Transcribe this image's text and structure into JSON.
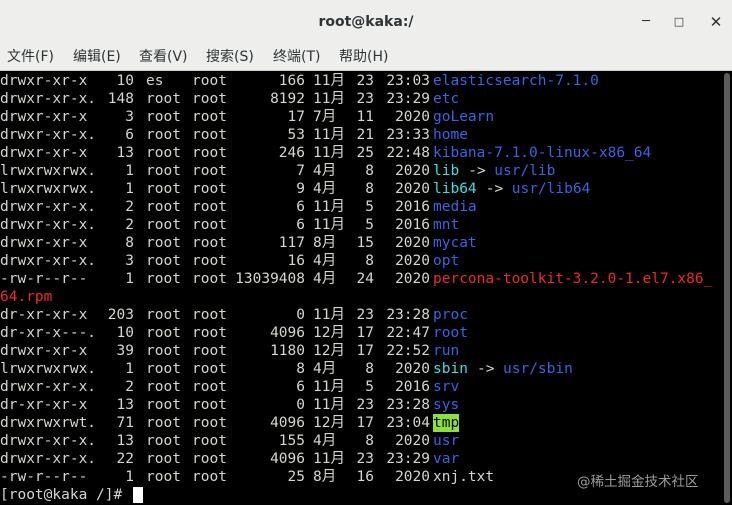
{
  "window": {
    "title": "root@kaka:/"
  },
  "menu": [
    "文件(F)",
    "编辑(E)",
    "查看(V)",
    "搜索(S)",
    "终端(T)",
    "帮助(H)"
  ],
  "rows": [
    {
      "perm": "drwxr-xr-x ",
      "links": "10",
      "owner": "es",
      "group": "root",
      "size": "166",
      "month": "11月",
      "day": "23",
      "time": "23:03",
      "name": "elasticsearch-7.1.0",
      "color": "blue"
    },
    {
      "perm": "drwxr-xr-x.",
      "links": "148",
      "owner": "root",
      "group": "root",
      "size": "8192",
      "month": "11月",
      "day": "23",
      "time": "23:29",
      "name": "etc",
      "color": "blue"
    },
    {
      "perm": "drwxr-xr-x ",
      "links": "3",
      "owner": "root",
      "group": "root",
      "size": "17",
      "month": "7月",
      "day": "11",
      "time": "2020",
      "name": "goLearn",
      "color": "blue"
    },
    {
      "perm": "drwxr-xr-x.",
      "links": "6",
      "owner": "root",
      "group": "root",
      "size": "53",
      "month": "11月",
      "day": "21",
      "time": "23:33",
      "name": "home",
      "color": "blue"
    },
    {
      "perm": "drwxr-xr-x ",
      "links": "13",
      "owner": "root",
      "group": "root",
      "size": "246",
      "month": "11月",
      "day": "25",
      "time": "22:48",
      "name": "kibana-7.1.0-linux-x86_64",
      "color": "blue"
    },
    {
      "perm": "lrwxrwxrwx.",
      "links": "1",
      "owner": "root",
      "group": "root",
      "size": "7",
      "month": "4月",
      "day": "8",
      "time": "2020",
      "name": "lib",
      "color": "cyan",
      "arrow": "->",
      "target": "usr/lib"
    },
    {
      "perm": "lrwxrwxrwx.",
      "links": "1",
      "owner": "root",
      "group": "root",
      "size": "9",
      "month": "4月",
      "day": "8",
      "time": "2020",
      "name": "lib64",
      "color": "cyan",
      "arrow": "->",
      "target": "usr/lib64"
    },
    {
      "perm": "drwxr-xr-x.",
      "links": "2",
      "owner": "root",
      "group": "root",
      "size": "6",
      "month": "11月",
      "day": "5",
      "time": "2016",
      "name": "media",
      "color": "blue"
    },
    {
      "perm": "drwxr-xr-x.",
      "links": "2",
      "owner": "root",
      "group": "root",
      "size": "6",
      "month": "11月",
      "day": "5",
      "time": "2016",
      "name": "mnt",
      "color": "blue"
    },
    {
      "perm": "drwxr-xr-x ",
      "links": "8",
      "owner": "root",
      "group": "root",
      "size": "117",
      "month": "8月",
      "day": "15",
      "time": "2020",
      "name": "mycat",
      "color": "blue"
    },
    {
      "perm": "drwxr-xr-x.",
      "links": "3",
      "owner": "root",
      "group": "root",
      "size": "16",
      "month": "4月",
      "day": "8",
      "time": "2020",
      "name": "opt",
      "color": "blue"
    },
    {
      "perm": "-rw-r--r-- ",
      "links": "1",
      "owner": "root",
      "group": "root",
      "size": "13039408",
      "month": "4月",
      "day": "24",
      "time": "2020",
      "name": "percona-toolkit-3.2.0-1.el7.x86_",
      "color": "red",
      "wrap": "64.rpm"
    },
    {
      "perm": "dr-xr-xr-x ",
      "links": "203",
      "owner": "root",
      "group": "root",
      "size": "0",
      "month": "11月",
      "day": "23",
      "time": "23:28",
      "name": "proc",
      "color": "blue"
    },
    {
      "perm": "dr-xr-x---.",
      "links": "10",
      "owner": "root",
      "group": "root",
      "size": "4096",
      "month": "12月",
      "day": "17",
      "time": "22:47",
      "name": "root",
      "color": "blue"
    },
    {
      "perm": "drwxr-xr-x ",
      "links": "39",
      "owner": "root",
      "group": "root",
      "size": "1180",
      "month": "12月",
      "day": "17",
      "time": "22:52",
      "name": "run",
      "color": "blue"
    },
    {
      "perm": "lrwxrwxrwx.",
      "links": "1",
      "owner": "root",
      "group": "root",
      "size": "8",
      "month": "4月",
      "day": "8",
      "time": "2020",
      "name": "sbin",
      "color": "cyan",
      "arrow": "->",
      "target": "usr/sbin"
    },
    {
      "perm": "drwxr-xr-x.",
      "links": "2",
      "owner": "root",
      "group": "root",
      "size": "6",
      "month": "11月",
      "day": "5",
      "time": "2016",
      "name": "srv",
      "color": "blue"
    },
    {
      "perm": "dr-xr-xr-x ",
      "links": "13",
      "owner": "root",
      "group": "root",
      "size": "0",
      "month": "11月",
      "day": "23",
      "time": "23:28",
      "name": "sys",
      "color": "blue"
    },
    {
      "perm": "drwxrwxrwt.",
      "links": "71",
      "owner": "root",
      "group": "root",
      "size": "4096",
      "month": "12月",
      "day": "17",
      "time": "23:04",
      "name": "tmp",
      "color": "gw"
    },
    {
      "perm": "drwxr-xr-x.",
      "links": "13",
      "owner": "root",
      "group": "root",
      "size": "155",
      "month": "4月",
      "day": "8",
      "time": "2020",
      "name": "usr",
      "color": "blue"
    },
    {
      "perm": "drwxr-xr-x.",
      "links": "22",
      "owner": "root",
      "group": "root",
      "size": "4096",
      "month": "11月",
      "day": "23",
      "time": "23:29",
      "name": "var",
      "color": "blue"
    },
    {
      "perm": "-rw-r--r-- ",
      "links": "1",
      "owner": "root",
      "group": "root",
      "size": "25",
      "month": "8月",
      "day": "16",
      "time": "2020",
      "name": "xnj.txt",
      "color": "plain"
    }
  ],
  "prompt": "[root@kaka /]# ",
  "watermark": "@稀土掘金技术社区",
  "colors": {
    "blue": "#3465e4",
    "cyan": "#34e2e2",
    "red": "#ef2929",
    "tmp_bg": "#8ae234",
    "fg": "#d3d7cf"
  }
}
